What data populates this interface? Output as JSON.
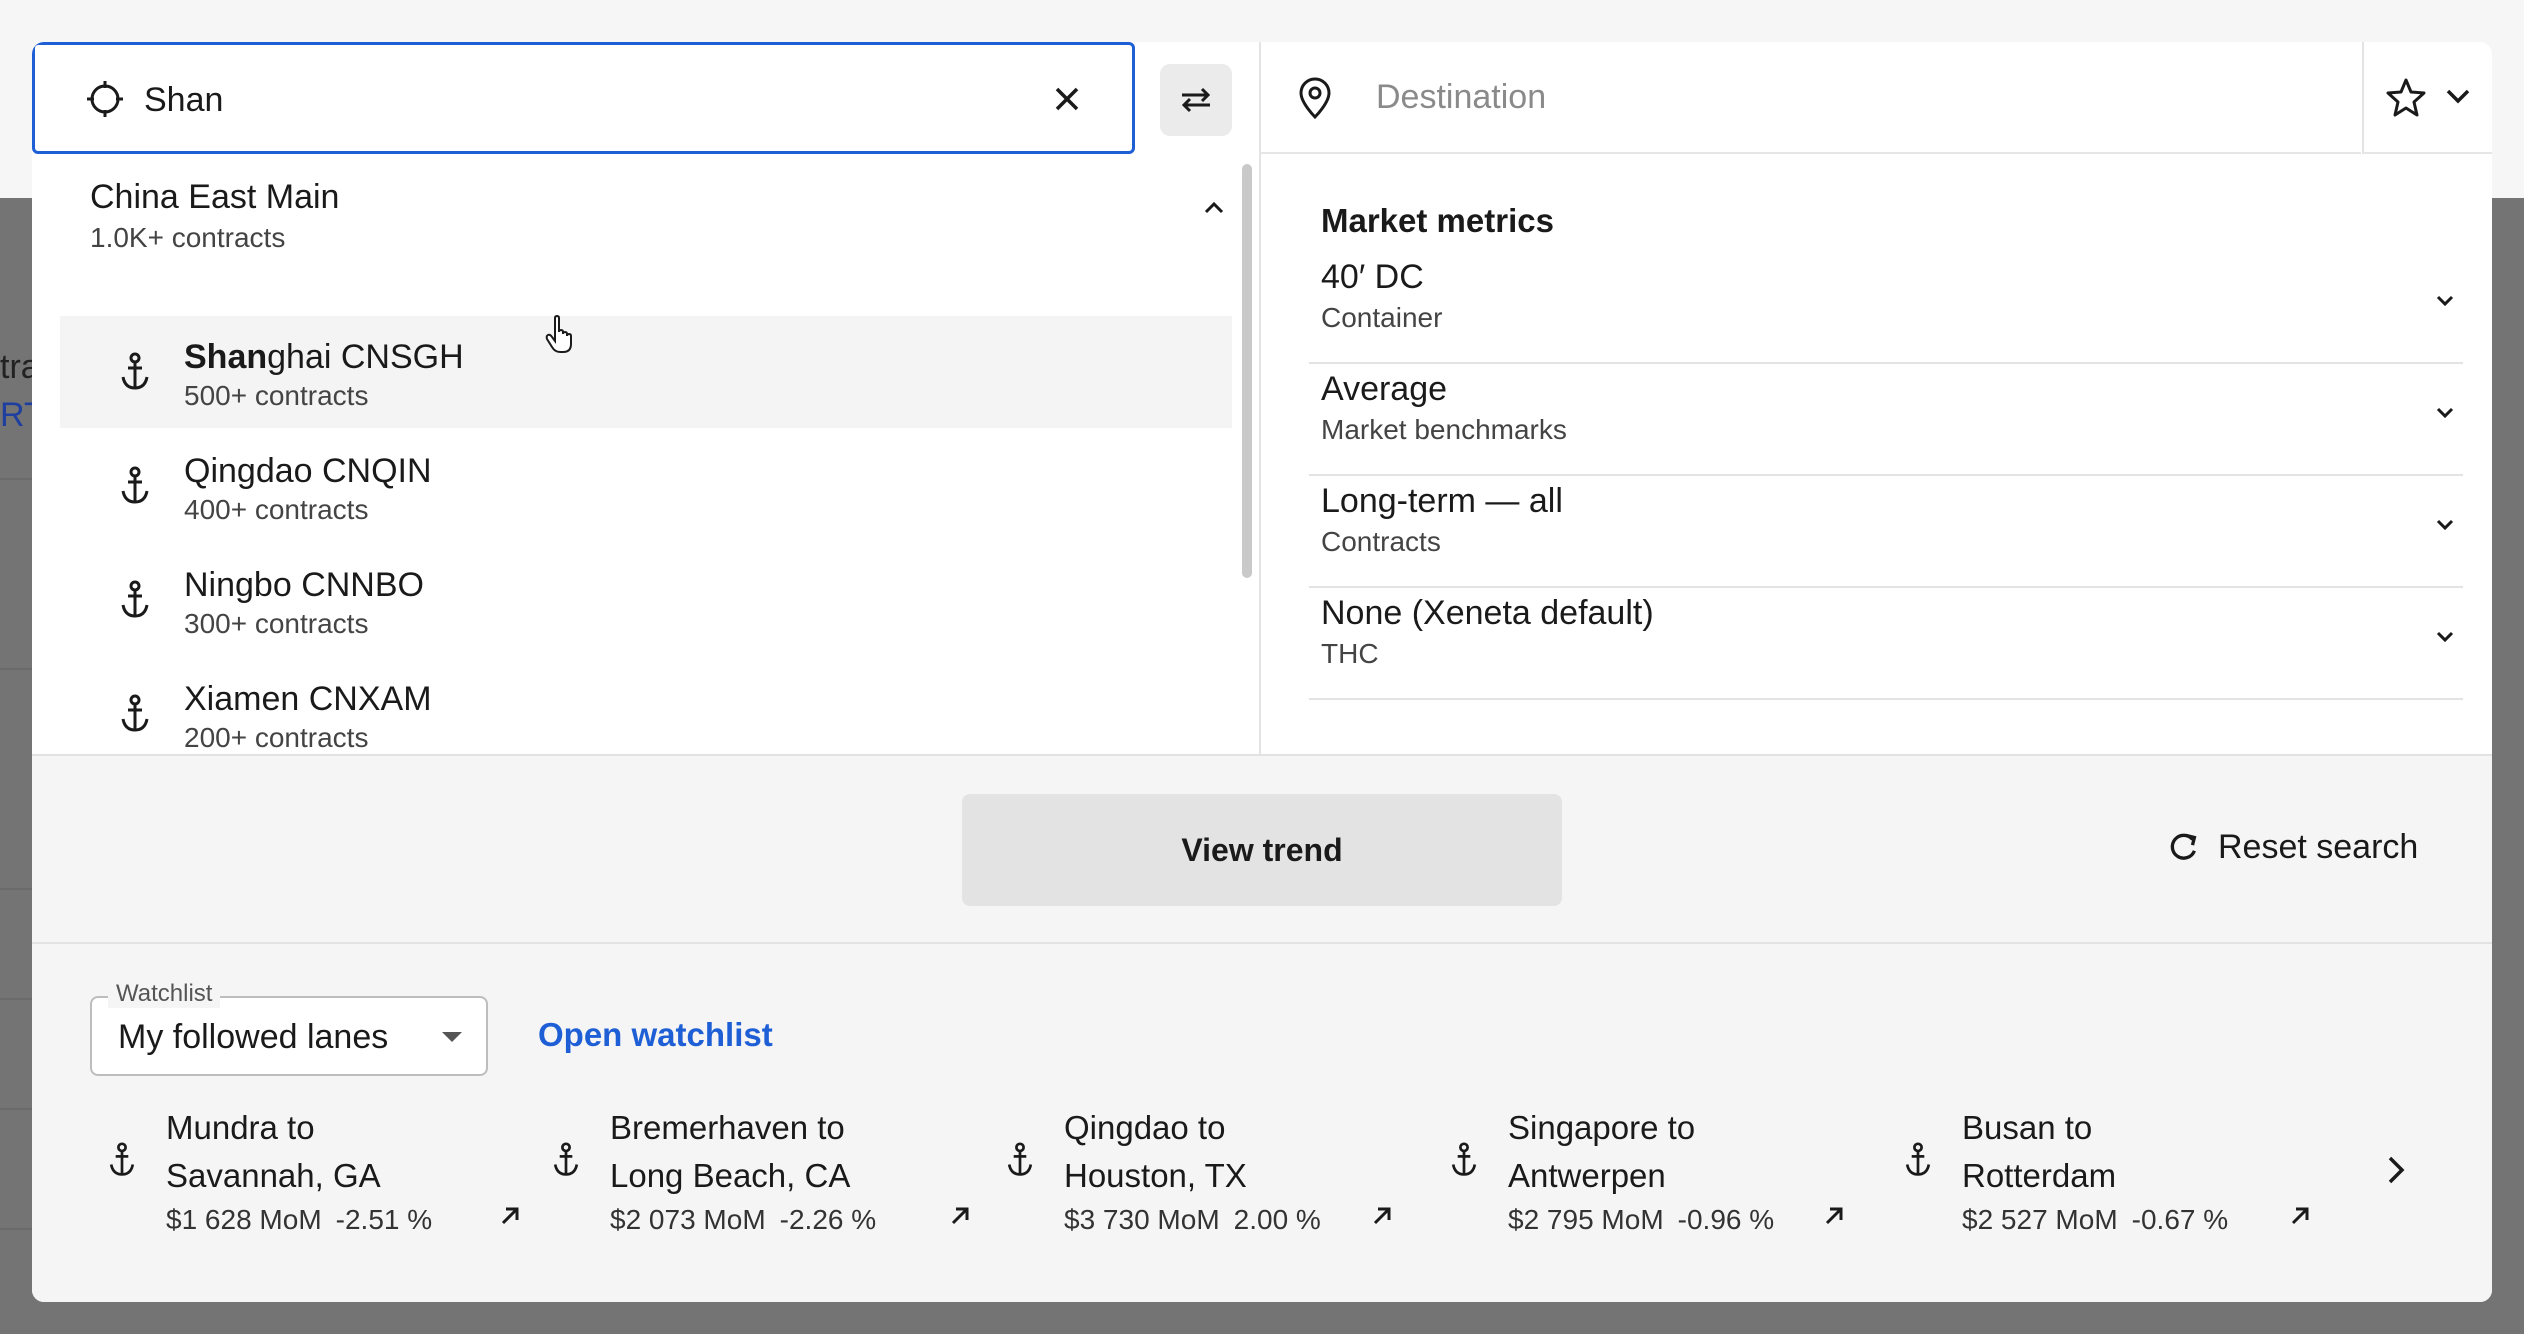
{
  "background": {
    "frag1": "tra",
    "frag2": "RT"
  },
  "search": {
    "origin_value": "Shan",
    "destination_placeholder": "Destination"
  },
  "results": {
    "group": {
      "name": "China East Main",
      "count": "1.0K+ contracts"
    },
    "items": [
      {
        "match": "Shan",
        "rest": "ghai CNSGH",
        "count": "500+ contracts",
        "highlighted": true
      },
      {
        "match": "",
        "rest": "Qingdao CNQIN",
        "count": "400+ contracts"
      },
      {
        "match": "",
        "rest": "Ningbo CNNBO",
        "count": "300+ contracts"
      },
      {
        "match": "",
        "rest": "Xiamen CNXAM",
        "count": "200+ contracts"
      }
    ]
  },
  "metrics": {
    "title": "Market metrics",
    "rows": [
      {
        "title": "40′ DC",
        "subtitle": "Container"
      },
      {
        "title": "Average",
        "subtitle": "Market benchmarks"
      },
      {
        "title": "Long-term — all",
        "subtitle": "Contracts"
      },
      {
        "title": "None (Xeneta default)",
        "subtitle": "THC"
      }
    ]
  },
  "actions": {
    "view_trend": "View trend",
    "reset": "Reset search"
  },
  "watchlist": {
    "legend": "Watchlist",
    "selected": "My followed lanes",
    "open_link": "Open watchlist",
    "lanes": [
      {
        "line1": "Mundra to",
        "line2": "Savannah, GA",
        "price": "$1 628 MoM",
        "pct": "-2.51 %"
      },
      {
        "line1": "Bremerhaven to",
        "line2": "Long Beach, CA",
        "price": "$2 073 MoM",
        "pct": "-2.26 %"
      },
      {
        "line1": "Qingdao to",
        "line2": "Houston, TX",
        "price": "$3 730 MoM",
        "pct": "2.00 %"
      },
      {
        "line1": "Singapore to",
        "line2": "Antwerpen",
        "price": "$2 795 MoM",
        "pct": "-0.96 %"
      },
      {
        "line1": "Busan to",
        "line2": "Rotterdam",
        "price": "$2 527 MoM",
        "pct": "-0.67 %"
      }
    ]
  },
  "colors": {
    "accent": "#1f5fd6",
    "overlay": "#747474",
    "panel": "#ffffff",
    "footer": "#f5f5f5"
  }
}
